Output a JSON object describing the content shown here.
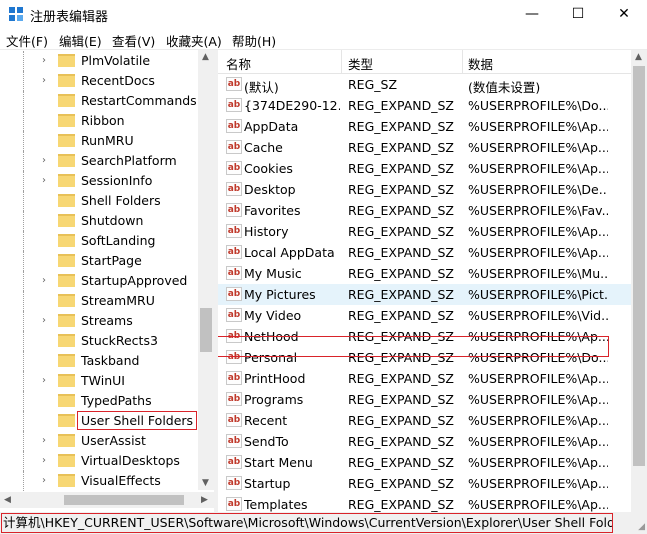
{
  "window": {
    "title": "注册表编辑器",
    "min_glyph": "—",
    "max_glyph": "☐",
    "close_glyph": "✕"
  },
  "menu": [
    "文件(F)",
    "编辑(E)",
    "查看(V)",
    "收藏夹(A)",
    "帮助(H)"
  ],
  "tree": {
    "items": [
      {
        "label": "PlmVolatile",
        "expandable": true
      },
      {
        "label": "RecentDocs",
        "expandable": true
      },
      {
        "label": "RestartCommands",
        "expandable": false
      },
      {
        "label": "Ribbon",
        "expandable": false
      },
      {
        "label": "RunMRU",
        "expandable": false
      },
      {
        "label": "SearchPlatform",
        "expandable": true
      },
      {
        "label": "SessionInfo",
        "expandable": true
      },
      {
        "label": "Shell Folders",
        "expandable": false
      },
      {
        "label": "Shutdown",
        "expandable": false
      },
      {
        "label": "SoftLanding",
        "expandable": false
      },
      {
        "label": "StartPage",
        "expandable": false
      },
      {
        "label": "StartupApproved",
        "expandable": true
      },
      {
        "label": "StreamMRU",
        "expandable": false
      },
      {
        "label": "Streams",
        "expandable": true
      },
      {
        "label": "StuckRects3",
        "expandable": false
      },
      {
        "label": "Taskband",
        "expandable": false
      },
      {
        "label": "TWinUI",
        "expandable": true
      },
      {
        "label": "TypedPaths",
        "expandable": false
      },
      {
        "label": "User Shell Folders",
        "expandable": false,
        "selected": true
      },
      {
        "label": "UserAssist",
        "expandable": true
      },
      {
        "label": "VirtualDesktops",
        "expandable": true
      },
      {
        "label": "VisualEffects",
        "expandable": true
      }
    ]
  },
  "list": {
    "columns": {
      "name": "名称",
      "type": "类型",
      "data": "数据"
    },
    "rows": [
      {
        "name": "(默认)",
        "type": "REG_SZ",
        "data": "(数值未设置)"
      },
      {
        "name": "{374DE290-12...",
        "type": "REG_EXPAND_SZ",
        "data": "%USERPROFILE%\\Do..."
      },
      {
        "name": "AppData",
        "type": "REG_EXPAND_SZ",
        "data": "%USERPROFILE%\\Ap..."
      },
      {
        "name": "Cache",
        "type": "REG_EXPAND_SZ",
        "data": "%USERPROFILE%\\Ap..."
      },
      {
        "name": "Cookies",
        "type": "REG_EXPAND_SZ",
        "data": "%USERPROFILE%\\Ap..."
      },
      {
        "name": "Desktop",
        "type": "REG_EXPAND_SZ",
        "data": "%USERPROFILE%\\De..."
      },
      {
        "name": "Favorites",
        "type": "REG_EXPAND_SZ",
        "data": "%USERPROFILE%\\Fav..."
      },
      {
        "name": "History",
        "type": "REG_EXPAND_SZ",
        "data": "%USERPROFILE%\\Ap..."
      },
      {
        "name": "Local AppData",
        "type": "REG_EXPAND_SZ",
        "data": "%USERPROFILE%\\Ap..."
      },
      {
        "name": "My Music",
        "type": "REG_EXPAND_SZ",
        "data": "%USERPROFILE%\\Mu..."
      },
      {
        "name": "My Pictures",
        "type": "REG_EXPAND_SZ",
        "data": "%USERPROFILE%\\Pict...",
        "selected": true
      },
      {
        "name": "My Video",
        "type": "REG_EXPAND_SZ",
        "data": "%USERPROFILE%\\Vid..."
      },
      {
        "name": "NetHood",
        "type": "REG_EXPAND_SZ",
        "data": "%USERPROFILE%\\Ap..."
      },
      {
        "name": "Personal",
        "type": "REG_EXPAND_SZ",
        "data": "%USERPROFILE%\\Do..."
      },
      {
        "name": "PrintHood",
        "type": "REG_EXPAND_SZ",
        "data": "%USERPROFILE%\\Ap..."
      },
      {
        "name": "Programs",
        "type": "REG_EXPAND_SZ",
        "data": "%USERPROFILE%\\Ap..."
      },
      {
        "name": "Recent",
        "type": "REG_EXPAND_SZ",
        "data": "%USERPROFILE%\\Ap..."
      },
      {
        "name": "SendTo",
        "type": "REG_EXPAND_SZ",
        "data": "%USERPROFILE%\\Ap..."
      },
      {
        "name": "Start Menu",
        "type": "REG_EXPAND_SZ",
        "data": "%USERPROFILE%\\Ap..."
      },
      {
        "name": "Startup",
        "type": "REG_EXPAND_SZ",
        "data": "%USERPROFILE%\\Ap..."
      },
      {
        "name": "Templates",
        "type": "REG_EXPAND_SZ",
        "data": "%USERPROFILE%\\Ap..."
      }
    ],
    "value_icon_text": "ab"
  },
  "status": {
    "path": "计算机\\HKEY_CURRENT_USER\\Software\\Microsoft\\Windows\\CurrentVersion\\Explorer\\User Shell Folders"
  },
  "colors": {
    "highlight_border": "#d9232a",
    "selected_row": "#e5f3fb",
    "folder": "#f7d774"
  }
}
